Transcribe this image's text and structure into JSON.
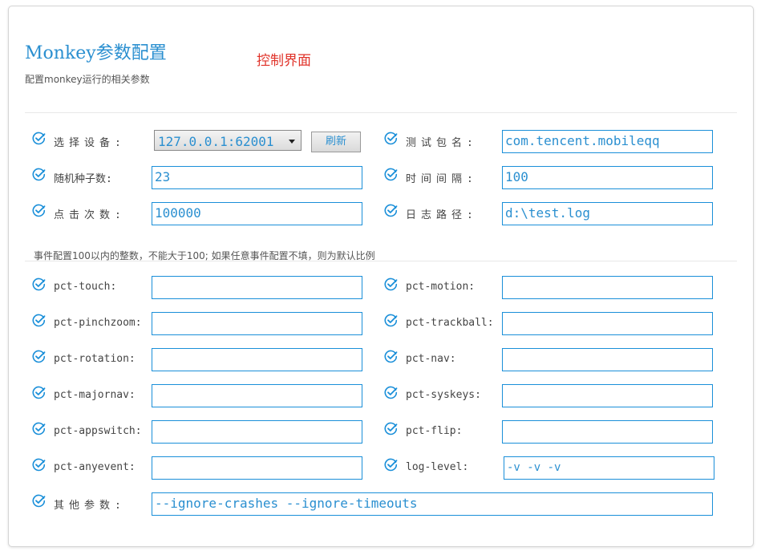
{
  "header": {
    "title": "Monkey参数配置",
    "subtitle": "配置monkey运行的相关参数",
    "annotation": "控制界面"
  },
  "accent_color": "#1a8fd9",
  "annotation_color": "#e0332a",
  "basic": {
    "device_label": "选择设备:",
    "device_value": "127.0.0.1:62001",
    "refresh_label": "刷新",
    "package_label": "测试包名:",
    "package_value": "com.tencent.mobileqq",
    "seed_label": "随机种子数:",
    "seed_value": "23",
    "interval_label": "时间间隔:",
    "interval_value": "100",
    "clicks_label": "点击次数:",
    "clicks_value": "100000",
    "logpath_label": "日志路径:",
    "logpath_value": "d:\\test.log"
  },
  "event_note": "事件配置100以内的整数，不能大于100; 如果任意事件配置不填，则为默认比例",
  "events": {
    "touch_label": "pct-touch:",
    "touch_value": "",
    "motion_label": "pct-motion:",
    "motion_value": "",
    "pinchzoom_label": "pct-pinchzoom:",
    "pinchzoom_value": "",
    "trackball_label": "pct-trackball:",
    "trackball_value": "",
    "rotation_label": "pct-rotation:",
    "rotation_value": "",
    "nav_label": "pct-nav:",
    "nav_value": "",
    "majornav_label": "pct-majornav:",
    "majornav_value": "",
    "syskeys_label": "pct-syskeys:",
    "syskeys_value": "",
    "appswitch_label": "pct-appswitch:",
    "appswitch_value": "",
    "flip_label": "pct-flip:",
    "flip_value": "",
    "anyevent_label": "pct-anyevent:",
    "anyevent_value": "",
    "loglevel_label": "log-level:",
    "loglevel_value": "-v -v -v"
  },
  "other": {
    "label": "其他参数:",
    "value": "--ignore-crashes --ignore-timeouts"
  },
  "icons": {
    "row_icon": "check-circle-icon"
  }
}
